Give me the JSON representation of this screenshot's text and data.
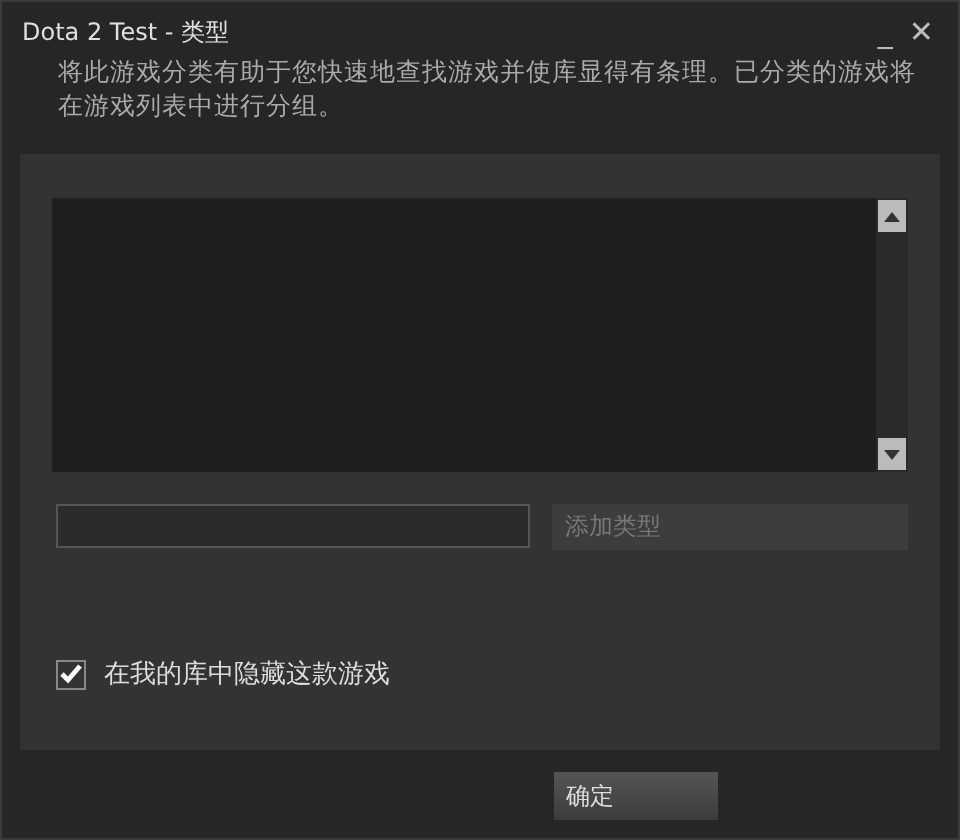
{
  "window": {
    "title": "Dota 2 Test - 类型",
    "minimize": "_",
    "close": "✕"
  },
  "description": "将此游戏分类有助于您快速地查找游戏并使库显得有条理。已分类的游戏将在游戏列表中进行分组。",
  "add_button": {
    "label": "添加类型",
    "disabled": true
  },
  "hide_checkbox": {
    "label": "在我的库中隐藏这款游戏",
    "checked": true
  },
  "ok_button": {
    "label": "确定"
  }
}
